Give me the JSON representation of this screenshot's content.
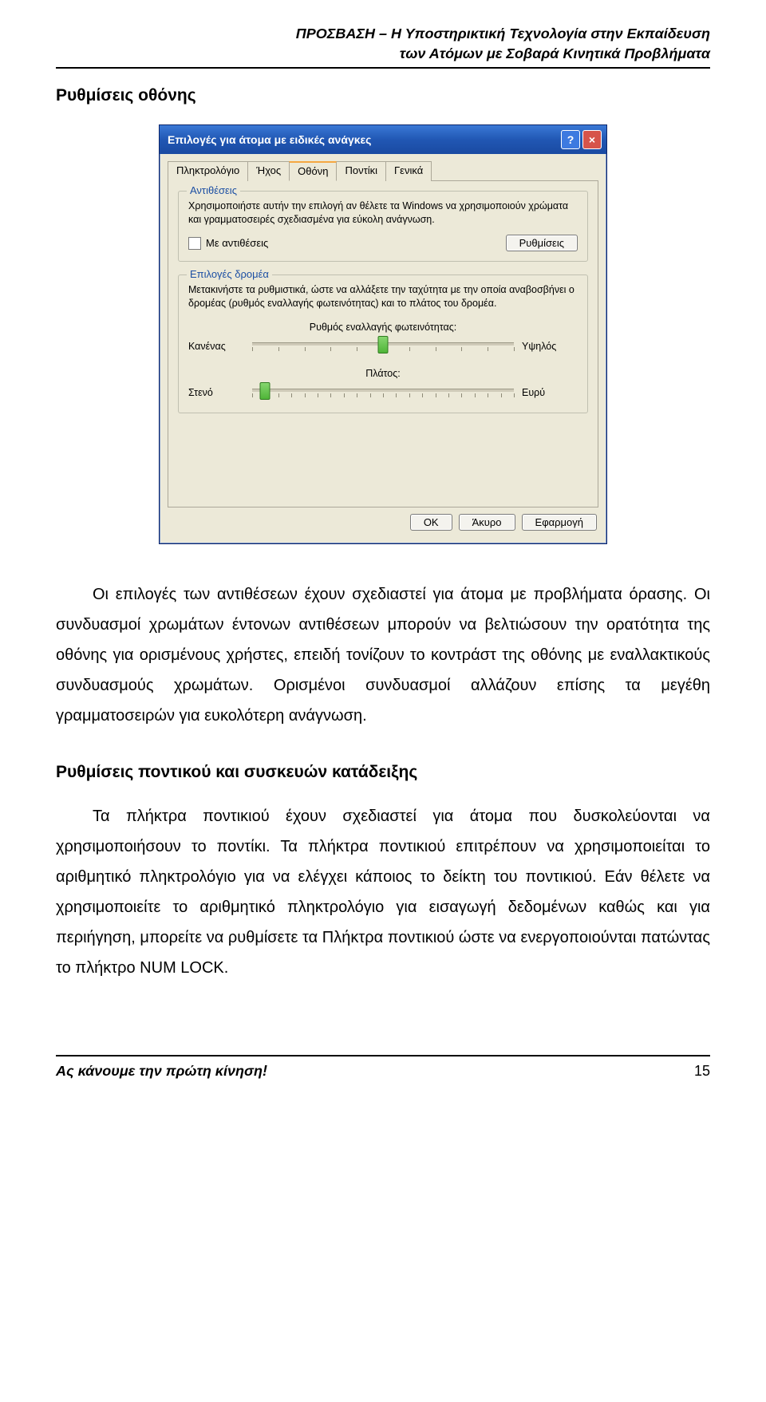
{
  "header": {
    "line1": "ΠΡΟΣΒΑΣΗ – Η Υποστηρικτική Τεχνολογία στην Εκπαίδευση",
    "line2": "των Ατόμων με Σοβαρά Κινητικά Προβλήματα"
  },
  "section1_heading": "Ρυθμίσεις οθόνης",
  "dialog": {
    "title": "Επιλογές για άτομα με ειδικές ανάγκες",
    "help_icon": "?",
    "close_icon": "×",
    "tabs": {
      "t0": "Πληκτρολόγιο",
      "t1": "Ήχος",
      "t2": "Οθόνη",
      "t3": "Ποντίκι",
      "t4": "Γενικά"
    },
    "group_contrast": {
      "legend": "Αντιθέσεις",
      "desc": "Χρησιμοποιήστε αυτήν την επιλογή αν θέλετε τα Windows να χρησιμοποιούν χρώματα και γραμματοσειρές σχεδιασμένα για εύκολη ανάγνωση.",
      "checkbox_label": "Με αντιθέσεις",
      "settings_btn": "Ρυθμίσεις"
    },
    "group_cursor": {
      "legend": "Επιλογές δρομέα",
      "desc": "Μετακινήστε τα ρυθμιστικά, ώστε να αλλάξετε την ταχύτητα με την οποία αναβοσβήνει ο δρομέας (ρυθμός εναλλαγής φωτεινότητας) και το πλάτος του δρομέα.",
      "slider1": {
        "title": "Ρυθμός εναλλαγής φωτεινότητας:",
        "left": "Κανένας",
        "right": "Υψηλός"
      },
      "slider2": {
        "title": "Πλάτος:",
        "left": "Στενό",
        "right": "Ευρύ"
      }
    },
    "buttons": {
      "ok": "OK",
      "cancel": "Άκυρο",
      "apply": "Εφαρμογή"
    }
  },
  "para1": "Οι επιλογές των αντιθέσεων έχουν σχεδιαστεί για άτομα με προβλήματα όρασης. Οι συνδυασμοί χρωμάτων έντονων αντιθέσεων μπορούν να βελτιώσουν την ορατότητα της οθόνης για ορισμένους χρήστες, επειδή τονίζουν το κοντράστ της οθόνης με εναλλακτικούς συνδυασμούς χρωμάτων. Ορισμένοι συνδυασμοί αλλάζουν επίσης τα μεγέθη γραμματοσειρών για ευκολότερη ανάγνωση.",
  "section2_heading": "Ρυθμίσεις ποντικού και συσκευών κατάδειξης",
  "para2": "Τα πλήκτρα ποντικιού έχουν σχεδιαστεί για άτομα που δυσκολεύονται να χρησιμοποιήσουν το ποντίκι. Τα πλήκτρα ποντικιού επιτρέπουν να χρησιμοποιείται το αριθμητικό πληκτρολόγιο για να ελέγχει κάποιος το δείκτη του ποντικιού. Εάν θέλετε να χρησιμοποιείτε το αριθμητικό πληκτρολόγιο για εισαγωγή δεδομένων καθώς και για περιήγηση, μπορείτε να ρυθμίσετε τα Πλήκτρα ποντικιού ώστε να ενεργοποιούνται πατώντας το πλήκτρο NUM LOCK.",
  "footer": {
    "text": "Ας κάνουμε την πρώτη κίνηση!",
    "page": "15"
  }
}
